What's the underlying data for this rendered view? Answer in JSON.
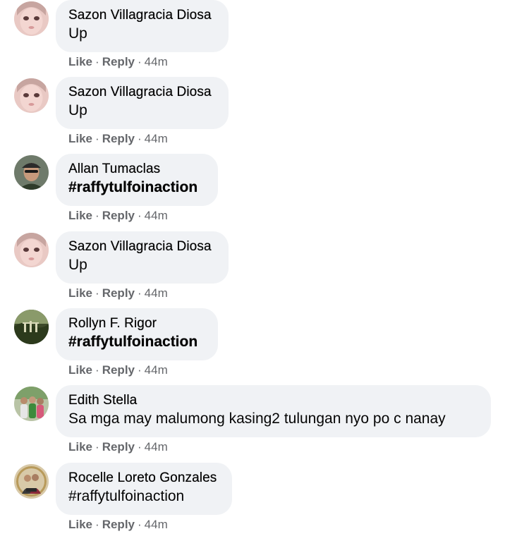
{
  "comments": [
    {
      "author": "Sazon Villagracia Diosa",
      "text": "Up",
      "like": "Like",
      "reply": "Reply",
      "time": "44m",
      "avatar": "pink-face-avatar"
    },
    {
      "author": "Sazon Villagracia Diosa",
      "text": "Up",
      "like": "Like",
      "reply": "Reply",
      "time": "44m",
      "avatar": "pink-face-avatar"
    },
    {
      "author": "Allan Tumaclas",
      "text": "#raffytulfoinaction",
      "like": "Like",
      "reply": "Reply",
      "time": "44m",
      "avatar": "man-with-cap-avatar"
    },
    {
      "author": "Sazon Villagracia Diosa",
      "text": "Up",
      "like": "Like",
      "reply": "Reply",
      "time": "44m",
      "avatar": "pink-face-avatar"
    },
    {
      "author": "Rollyn F. Rigor",
      "text": "#raffytulfoinaction",
      "like": "Like",
      "reply": "Reply",
      "time": "44m",
      "avatar": "green-landscape-avatar"
    },
    {
      "author": "Edith Stella",
      "text": "Sa mga may malumong kasing2 tulungan nyo po c nanay",
      "like": "Like",
      "reply": "Reply",
      "time": "44m",
      "avatar": "group-photo-avatar"
    },
    {
      "author": "Rocelle Loreto Gonzales",
      "text": "#raffytulfoinaction",
      "like": "Like",
      "reply": "Reply",
      "time": "44m",
      "avatar": "couple-photo-avatar"
    }
  ],
  "colors": {
    "bubble": "#f0f2f5",
    "text": "#050505",
    "meta": "#65676b"
  }
}
